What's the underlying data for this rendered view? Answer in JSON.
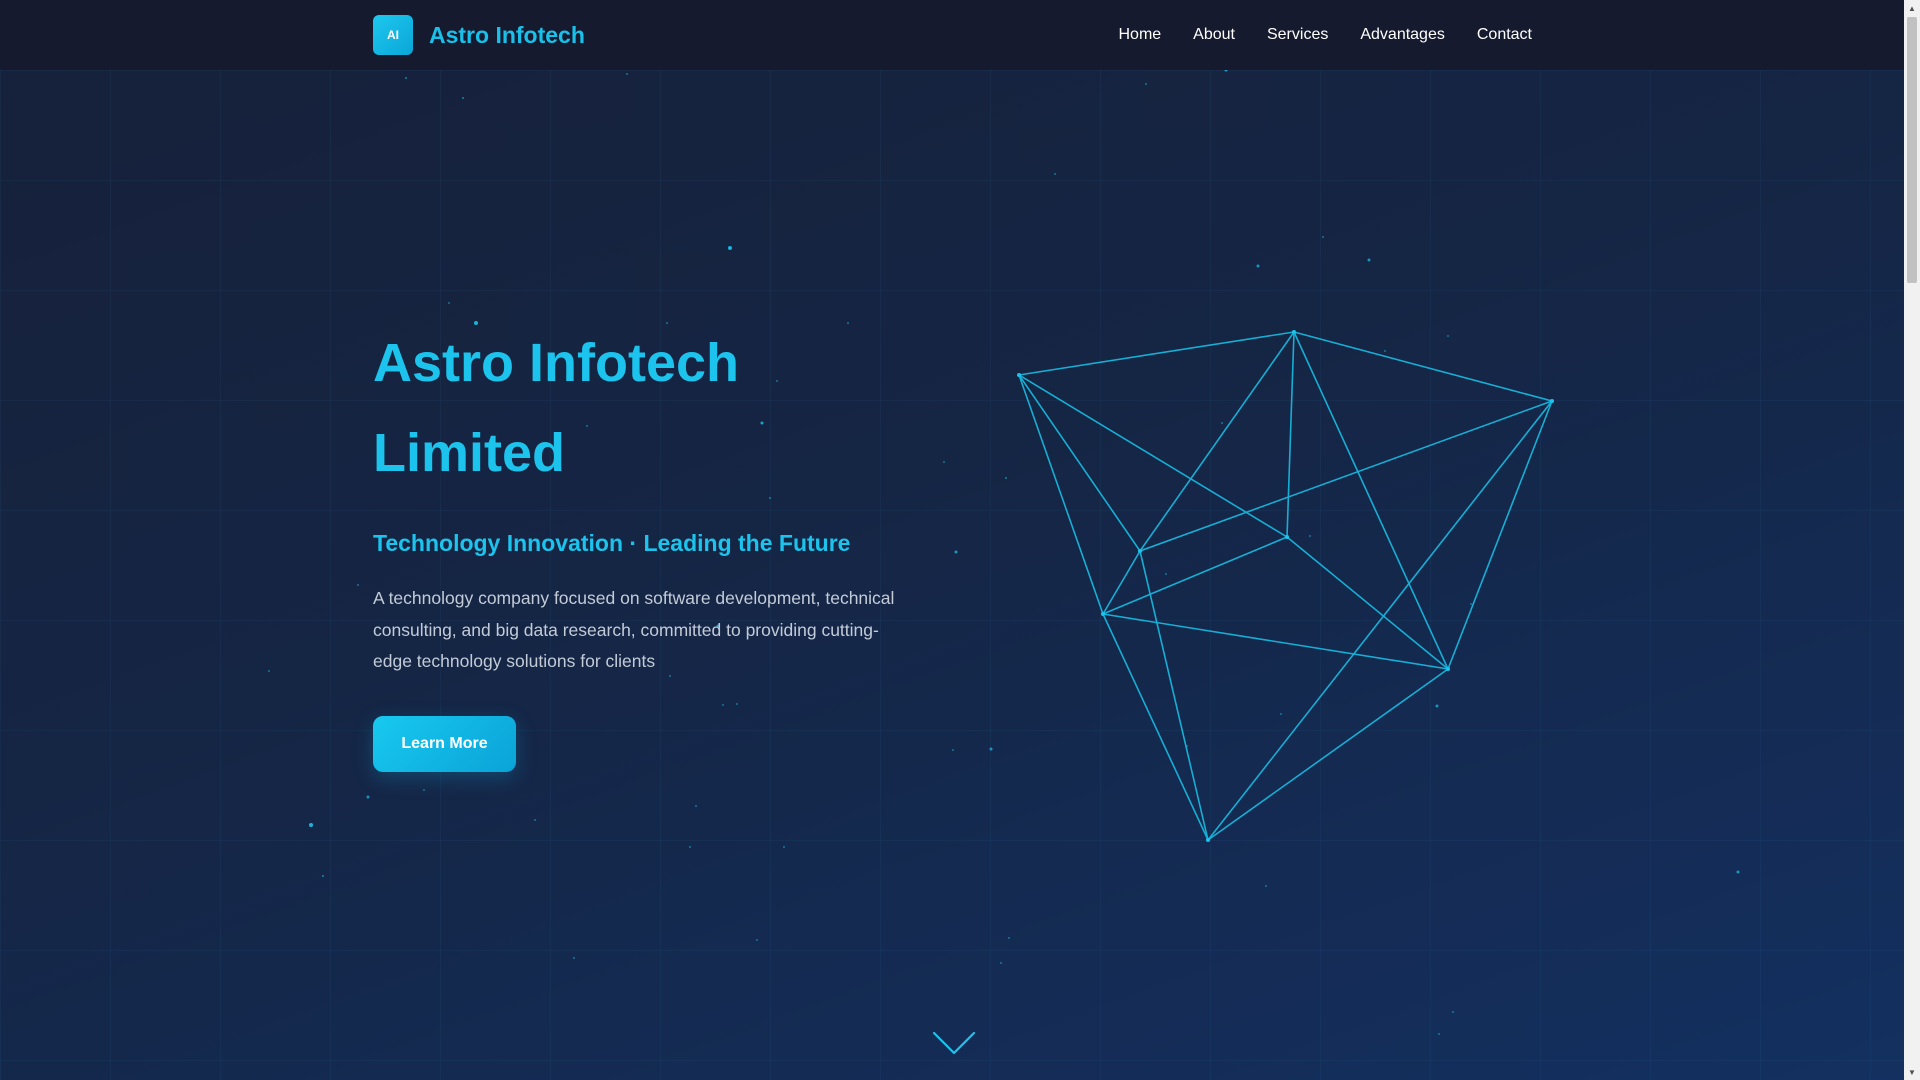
{
  "brand": {
    "logo_text": "AI",
    "name": "Astro Infotech"
  },
  "nav": {
    "items": [
      "Home",
      "About",
      "Services",
      "Advantages",
      "Contact"
    ]
  },
  "hero": {
    "title_line1": "Astro Infotech",
    "title_line2": "Limited",
    "tagline": "Technology Innovation · Leading the Future",
    "description": "A technology company focused on software development, technical consulting, and big data research, committed to providing cutting-edge technology solutions for clients",
    "cta_label": "Learn More"
  },
  "icons": {
    "scroll_down": "chevron-down-icon",
    "scroll_up": "scroll-up-arrow-icon",
    "scroll_down_arrow": "scroll-down-arrow-icon"
  },
  "colors": {
    "accent": "#1cc3ec",
    "nav_bg": "#161a2e",
    "page_bg": "#152544",
    "body_text": "#c3cbd8"
  }
}
